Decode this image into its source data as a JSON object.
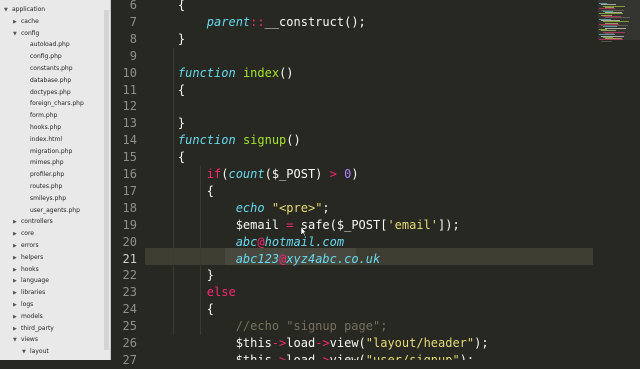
{
  "sidebar": {
    "items": [
      {
        "label": "application",
        "type": "folder",
        "level": 0
      },
      {
        "label": "cache",
        "type": "folder",
        "level": 1
      },
      {
        "label": "config",
        "type": "folder",
        "level": 1
      },
      {
        "label": "autoload.php",
        "type": "file",
        "level": 2
      },
      {
        "label": "config.php",
        "type": "file",
        "level": 2
      },
      {
        "label": "constants.php",
        "type": "file",
        "level": 2
      },
      {
        "label": "database.php",
        "type": "file",
        "level": 2
      },
      {
        "label": "doctypes.php",
        "type": "file",
        "level": 2
      },
      {
        "label": "foreign_chars.php",
        "type": "file",
        "level": 2
      },
      {
        "label": "form.php",
        "type": "file",
        "level": 2
      },
      {
        "label": "hooks.php",
        "type": "file",
        "level": 2
      },
      {
        "label": "index.html",
        "type": "file",
        "level": 2
      },
      {
        "label": "migration.php",
        "type": "file",
        "level": 2
      },
      {
        "label": "mimes.php",
        "type": "file",
        "level": 2
      },
      {
        "label": "profiler.php",
        "type": "file",
        "level": 2
      },
      {
        "label": "routes.php",
        "type": "file",
        "level": 2
      },
      {
        "label": "smileys.php",
        "type": "file",
        "level": 2
      },
      {
        "label": "user_agents.php",
        "type": "file",
        "level": 2
      },
      {
        "label": "controllers",
        "type": "folder",
        "level": 1
      },
      {
        "label": "core",
        "type": "folder",
        "level": 1
      },
      {
        "label": "errors",
        "type": "folder",
        "level": 1
      },
      {
        "label": "helpers",
        "type": "folder",
        "level": 1
      },
      {
        "label": "hooks",
        "type": "folder",
        "level": 1
      },
      {
        "label": "language",
        "type": "folder",
        "level": 1
      },
      {
        "label": "libraries",
        "type": "folder",
        "level": 1
      },
      {
        "label": "logs",
        "type": "folder",
        "level": 1
      },
      {
        "label": "models",
        "type": "folder",
        "level": 1
      },
      {
        "label": "third_party",
        "type": "folder",
        "level": 1
      },
      {
        "label": "views",
        "type": "folder",
        "level": 1
      },
      {
        "label": "layout",
        "type": "folder",
        "level": 2
      }
    ]
  },
  "editor": {
    "current_line": 21,
    "lines": [
      {
        "num": "6",
        "tokens": [
          {
            "t": "    ",
            "c": "pl"
          },
          {
            "t": "{",
            "c": "pl"
          }
        ]
      },
      {
        "num": "7",
        "tokens": [
          {
            "t": "        ",
            "c": "pl"
          },
          {
            "t": "parent",
            "c": "kw"
          },
          {
            "t": "::",
            "c": "ctl"
          },
          {
            "t": "__construct",
            "c": "pl"
          },
          {
            "t": "();",
            "c": "pl"
          }
        ]
      },
      {
        "num": "8",
        "tokens": [
          {
            "t": "    ",
            "c": "pl"
          },
          {
            "t": "}",
            "c": "pl"
          }
        ]
      },
      {
        "num": "9",
        "tokens": []
      },
      {
        "num": "10",
        "tokens": [
          {
            "t": "    ",
            "c": "pl"
          },
          {
            "t": "function",
            "c": "kw"
          },
          {
            "t": " ",
            "c": "pl"
          },
          {
            "t": "index",
            "c": "fn"
          },
          {
            "t": "()",
            "c": "pl"
          }
        ]
      },
      {
        "num": "11",
        "tokens": [
          {
            "t": "    ",
            "c": "pl"
          },
          {
            "t": "{",
            "c": "pl"
          }
        ]
      },
      {
        "num": "12",
        "tokens": []
      },
      {
        "num": "13",
        "tokens": [
          {
            "t": "    ",
            "c": "pl"
          },
          {
            "t": "}",
            "c": "pl"
          }
        ]
      },
      {
        "num": "14",
        "tokens": [
          {
            "t": "    ",
            "c": "pl"
          },
          {
            "t": "function",
            "c": "kw"
          },
          {
            "t": " ",
            "c": "pl"
          },
          {
            "t": "signup",
            "c": "fn"
          },
          {
            "t": "()",
            "c": "pl"
          }
        ]
      },
      {
        "num": "15",
        "tokens": [
          {
            "t": "    ",
            "c": "pl"
          },
          {
            "t": "{",
            "c": "pl"
          }
        ]
      },
      {
        "num": "16",
        "tokens": [
          {
            "t": "        ",
            "c": "pl"
          },
          {
            "t": "if",
            "c": "ctl"
          },
          {
            "t": "(",
            "c": "pl"
          },
          {
            "t": "count",
            "c": "kw"
          },
          {
            "t": "($_POST) ",
            "c": "pl"
          },
          {
            "t": ">",
            "c": "ctl"
          },
          {
            "t": " ",
            "c": "pl"
          },
          {
            "t": "0",
            "c": "num"
          },
          {
            "t": ")",
            "c": "pl"
          }
        ]
      },
      {
        "num": "17",
        "tokens": [
          {
            "t": "        ",
            "c": "pl"
          },
          {
            "t": "{",
            "c": "pl"
          }
        ]
      },
      {
        "num": "18",
        "tokens": [
          {
            "t": "            ",
            "c": "pl"
          },
          {
            "t": "echo",
            "c": "kw"
          },
          {
            "t": " ",
            "c": "pl"
          },
          {
            "t": "\"<pre>\"",
            "c": "str"
          },
          {
            "t": ";",
            "c": "pl"
          }
        ]
      },
      {
        "num": "19",
        "tokens": [
          {
            "t": "            ",
            "c": "pl"
          },
          {
            "t": "$email ",
            "c": "pl"
          },
          {
            "t": "=",
            "c": "ctl"
          },
          {
            "t": " safe($_POST[",
            "c": "pl"
          },
          {
            "t": "'email'",
            "c": "str"
          },
          {
            "t": "]);",
            "c": "pl"
          }
        ]
      },
      {
        "num": "20",
        "tokens": [
          {
            "t": "            ",
            "c": "pl"
          },
          {
            "t": "abc",
            "c": "kw"
          },
          {
            "t": "@",
            "c": "ctl"
          },
          {
            "t": "hotmail.com",
            "c": "kw"
          }
        ]
      },
      {
        "num": "21",
        "tokens": [
          {
            "t": "            ",
            "c": "pl"
          },
          {
            "t": "abc123",
            "c": "kw"
          },
          {
            "t": "@",
            "c": "ctl"
          },
          {
            "t": "xyz4abc.co.uk",
            "c": "kw"
          }
        ]
      },
      {
        "num": "22",
        "tokens": [
          {
            "t": "        ",
            "c": "pl"
          },
          {
            "t": "}",
            "c": "pl"
          }
        ]
      },
      {
        "num": "23",
        "tokens": [
          {
            "t": "        ",
            "c": "pl"
          },
          {
            "t": "else",
            "c": "ctl"
          }
        ]
      },
      {
        "num": "24",
        "tokens": [
          {
            "t": "        ",
            "c": "pl"
          },
          {
            "t": "{",
            "c": "pl"
          }
        ]
      },
      {
        "num": "25",
        "tokens": [
          {
            "t": "            ",
            "c": "pl"
          },
          {
            "t": "//echo \"signup page\";",
            "c": "com"
          }
        ]
      },
      {
        "num": "26",
        "tokens": [
          {
            "t": "            ",
            "c": "pl"
          },
          {
            "t": "$this",
            "c": "pl"
          },
          {
            "t": "->",
            "c": "ctl"
          },
          {
            "t": "load",
            "c": "pl"
          },
          {
            "t": "->",
            "c": "ctl"
          },
          {
            "t": "view(",
            "c": "pl"
          },
          {
            "t": "\"layout/header\"",
            "c": "str"
          },
          {
            "t": ");",
            "c": "pl"
          }
        ]
      },
      {
        "num": "27",
        "tokens": [
          {
            "t": "            ",
            "c": "pl"
          },
          {
            "t": "$this",
            "c": "pl"
          },
          {
            "t": "->",
            "c": "ctl"
          },
          {
            "t": "load",
            "c": "pl"
          },
          {
            "t": "->",
            "c": "ctl"
          },
          {
            "t": "view(",
            "c": "pl"
          },
          {
            "t": "\"user/signup\"",
            "c": "str"
          },
          {
            "t": ");",
            "c": "pl"
          }
        ]
      }
    ]
  },
  "colors": {
    "background": "#272822",
    "keyword": "#66d9ef",
    "function": "#a6e22e",
    "control": "#f92672",
    "string": "#e6db74",
    "number": "#ae81ff",
    "comment": "#75715e",
    "sidebar_bg": "#e9e9e9"
  }
}
